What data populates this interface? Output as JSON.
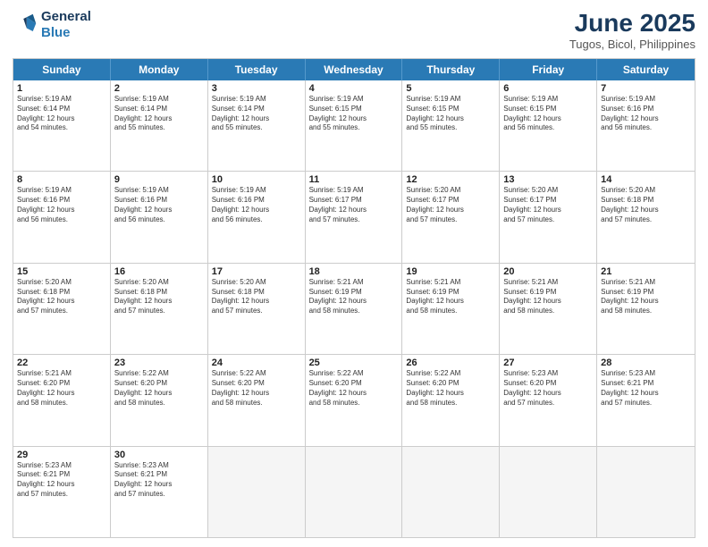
{
  "logo": {
    "line1": "General",
    "line2": "Blue"
  },
  "title": "June 2025",
  "location": "Tugos, Bicol, Philippines",
  "days": [
    "Sunday",
    "Monday",
    "Tuesday",
    "Wednesday",
    "Thursday",
    "Friday",
    "Saturday"
  ],
  "rows": [
    [
      {
        "day": "1",
        "info": "Sunrise: 5:19 AM\nSunset: 6:14 PM\nDaylight: 12 hours\nand 54 minutes."
      },
      {
        "day": "2",
        "info": "Sunrise: 5:19 AM\nSunset: 6:14 PM\nDaylight: 12 hours\nand 55 minutes."
      },
      {
        "day": "3",
        "info": "Sunrise: 5:19 AM\nSunset: 6:14 PM\nDaylight: 12 hours\nand 55 minutes."
      },
      {
        "day": "4",
        "info": "Sunrise: 5:19 AM\nSunset: 6:15 PM\nDaylight: 12 hours\nand 55 minutes."
      },
      {
        "day": "5",
        "info": "Sunrise: 5:19 AM\nSunset: 6:15 PM\nDaylight: 12 hours\nand 55 minutes."
      },
      {
        "day": "6",
        "info": "Sunrise: 5:19 AM\nSunset: 6:15 PM\nDaylight: 12 hours\nand 56 minutes."
      },
      {
        "day": "7",
        "info": "Sunrise: 5:19 AM\nSunset: 6:16 PM\nDaylight: 12 hours\nand 56 minutes."
      }
    ],
    [
      {
        "day": "8",
        "info": "Sunrise: 5:19 AM\nSunset: 6:16 PM\nDaylight: 12 hours\nand 56 minutes."
      },
      {
        "day": "9",
        "info": "Sunrise: 5:19 AM\nSunset: 6:16 PM\nDaylight: 12 hours\nand 56 minutes."
      },
      {
        "day": "10",
        "info": "Sunrise: 5:19 AM\nSunset: 6:16 PM\nDaylight: 12 hours\nand 56 minutes."
      },
      {
        "day": "11",
        "info": "Sunrise: 5:19 AM\nSunset: 6:17 PM\nDaylight: 12 hours\nand 57 minutes."
      },
      {
        "day": "12",
        "info": "Sunrise: 5:20 AM\nSunset: 6:17 PM\nDaylight: 12 hours\nand 57 minutes."
      },
      {
        "day": "13",
        "info": "Sunrise: 5:20 AM\nSunset: 6:17 PM\nDaylight: 12 hours\nand 57 minutes."
      },
      {
        "day": "14",
        "info": "Sunrise: 5:20 AM\nSunset: 6:18 PM\nDaylight: 12 hours\nand 57 minutes."
      }
    ],
    [
      {
        "day": "15",
        "info": "Sunrise: 5:20 AM\nSunset: 6:18 PM\nDaylight: 12 hours\nand 57 minutes."
      },
      {
        "day": "16",
        "info": "Sunrise: 5:20 AM\nSunset: 6:18 PM\nDaylight: 12 hours\nand 57 minutes."
      },
      {
        "day": "17",
        "info": "Sunrise: 5:20 AM\nSunset: 6:18 PM\nDaylight: 12 hours\nand 57 minutes."
      },
      {
        "day": "18",
        "info": "Sunrise: 5:21 AM\nSunset: 6:19 PM\nDaylight: 12 hours\nand 58 minutes."
      },
      {
        "day": "19",
        "info": "Sunrise: 5:21 AM\nSunset: 6:19 PM\nDaylight: 12 hours\nand 58 minutes."
      },
      {
        "day": "20",
        "info": "Sunrise: 5:21 AM\nSunset: 6:19 PM\nDaylight: 12 hours\nand 58 minutes."
      },
      {
        "day": "21",
        "info": "Sunrise: 5:21 AM\nSunset: 6:19 PM\nDaylight: 12 hours\nand 58 minutes."
      }
    ],
    [
      {
        "day": "22",
        "info": "Sunrise: 5:21 AM\nSunset: 6:20 PM\nDaylight: 12 hours\nand 58 minutes."
      },
      {
        "day": "23",
        "info": "Sunrise: 5:22 AM\nSunset: 6:20 PM\nDaylight: 12 hours\nand 58 minutes."
      },
      {
        "day": "24",
        "info": "Sunrise: 5:22 AM\nSunset: 6:20 PM\nDaylight: 12 hours\nand 58 minutes."
      },
      {
        "day": "25",
        "info": "Sunrise: 5:22 AM\nSunset: 6:20 PM\nDaylight: 12 hours\nand 58 minutes."
      },
      {
        "day": "26",
        "info": "Sunrise: 5:22 AM\nSunset: 6:20 PM\nDaylight: 12 hours\nand 58 minutes."
      },
      {
        "day": "27",
        "info": "Sunrise: 5:23 AM\nSunset: 6:20 PM\nDaylight: 12 hours\nand 57 minutes."
      },
      {
        "day": "28",
        "info": "Sunrise: 5:23 AM\nSunset: 6:21 PM\nDaylight: 12 hours\nand 57 minutes."
      }
    ],
    [
      {
        "day": "29",
        "info": "Sunrise: 5:23 AM\nSunset: 6:21 PM\nDaylight: 12 hours\nand 57 minutes."
      },
      {
        "day": "30",
        "info": "Sunrise: 5:23 AM\nSunset: 6:21 PM\nDaylight: 12 hours\nand 57 minutes."
      },
      null,
      null,
      null,
      null,
      null
    ]
  ]
}
